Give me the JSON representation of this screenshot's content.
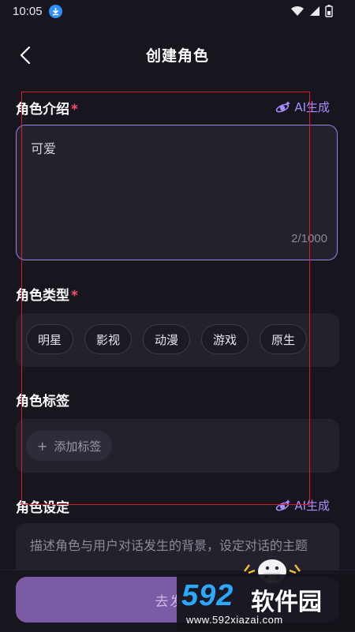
{
  "status_bar": {
    "time": "10:05",
    "icons": [
      "download-icon",
      "wifi-icon",
      "signal-icon",
      "battery-icon"
    ]
  },
  "header": {
    "title": "创建角色",
    "back_icon": "chevron-left-icon"
  },
  "intro": {
    "label": "角色介绍",
    "required_mark": "*",
    "ai_label": "AI生成",
    "value": "可爱",
    "counter": "2/1000"
  },
  "type": {
    "label": "角色类型",
    "required_mark": "*",
    "options": [
      "明星",
      "影视",
      "动漫",
      "游戏",
      "原生"
    ]
  },
  "tags": {
    "label": "角色标签",
    "add_label": "添加标签",
    "add_icon": "+"
  },
  "setting": {
    "label": "角色设定",
    "ai_label": "AI生成",
    "placeholder": "描述角色与用户对话发生的背景，设定对话的主题"
  },
  "footer": {
    "publish_label": "去发布"
  },
  "watermark": {
    "logo": "592",
    "name": "软件园",
    "url": "www.592xiazai.com"
  },
  "colors": {
    "background": "#17161f",
    "panel": "#22212c",
    "accent": "#a98cff",
    "required": "#ff4d6d",
    "button": "#7b5aa6",
    "annotation": "#e0182d"
  }
}
